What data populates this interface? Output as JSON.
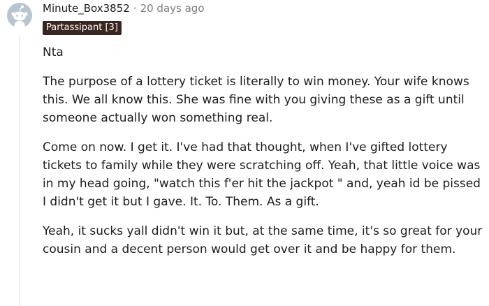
{
  "comment": {
    "username": "Minute_Box3852",
    "separator": "·",
    "timestamp": "20 days ago",
    "flair": "Partassipant [3]",
    "avatar_icon": "snoo-avatar-icon",
    "colors": {
      "avatar_bg": "#b7c4d1",
      "avatar_fg": "#ffffff",
      "flair_bg": "#3a2620",
      "flair_text": "#ffffff",
      "meta_gray": "#7c7c7c",
      "thread_line": "#edeff1"
    },
    "paragraphs": [
      "Nta",
      "The purpose of a lottery ticket is literally to win money. Your wife knows this. We all know this. She was fine with you giving these as a gift until someone actually won something real.",
      "Come on now. I get it. I've had that thought, when I've gifted lottery tickets to family while they were scratching off. Yeah, that little voice was in my head going, \"watch this f'er hit the jackpot \" and, yeah id be pissed I didn't get it but I gave. It. To. Them. As a gift.",
      "Yeah, it sucks yall didn't win it but, at the same time, it's so great for your cousin and a decent person would get over it and be happy for them."
    ]
  }
}
